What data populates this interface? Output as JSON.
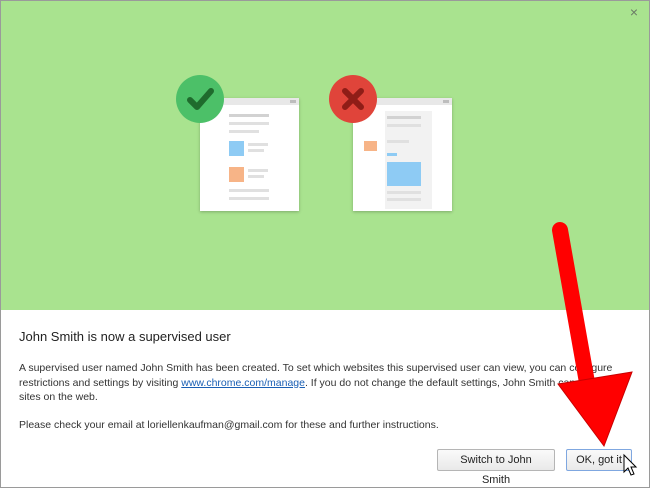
{
  "dialog": {
    "close_glyph": "×",
    "heading": "John Smith is now a supervised user",
    "desc_before": "A supervised user named John Smith has been created. To set which websites this supervised user can view, you can configure restrictions and settings by visiting ",
    "desc_link": "www.chrome.com/manage",
    "desc_after": ". If you do not change the default settings, John Smith can browse all sites on the web.",
    "email_note": "Please check your email at loriellenkaufman@gmail.com for these and further instructions.",
    "buttons": {
      "switch_label": "Switch to John Smith",
      "ok_label": "OK, got it"
    }
  },
  "colors": {
    "hero_bg": "#a9e38f",
    "allowed_badge": "#4cc068",
    "blocked_badge": "#e0443a",
    "annotation_arrow": "#ff0000"
  },
  "icons": {
    "allowed": "check-icon",
    "blocked": "x-icon",
    "close": "close-icon",
    "cursor": "mouse-pointer-icon"
  }
}
